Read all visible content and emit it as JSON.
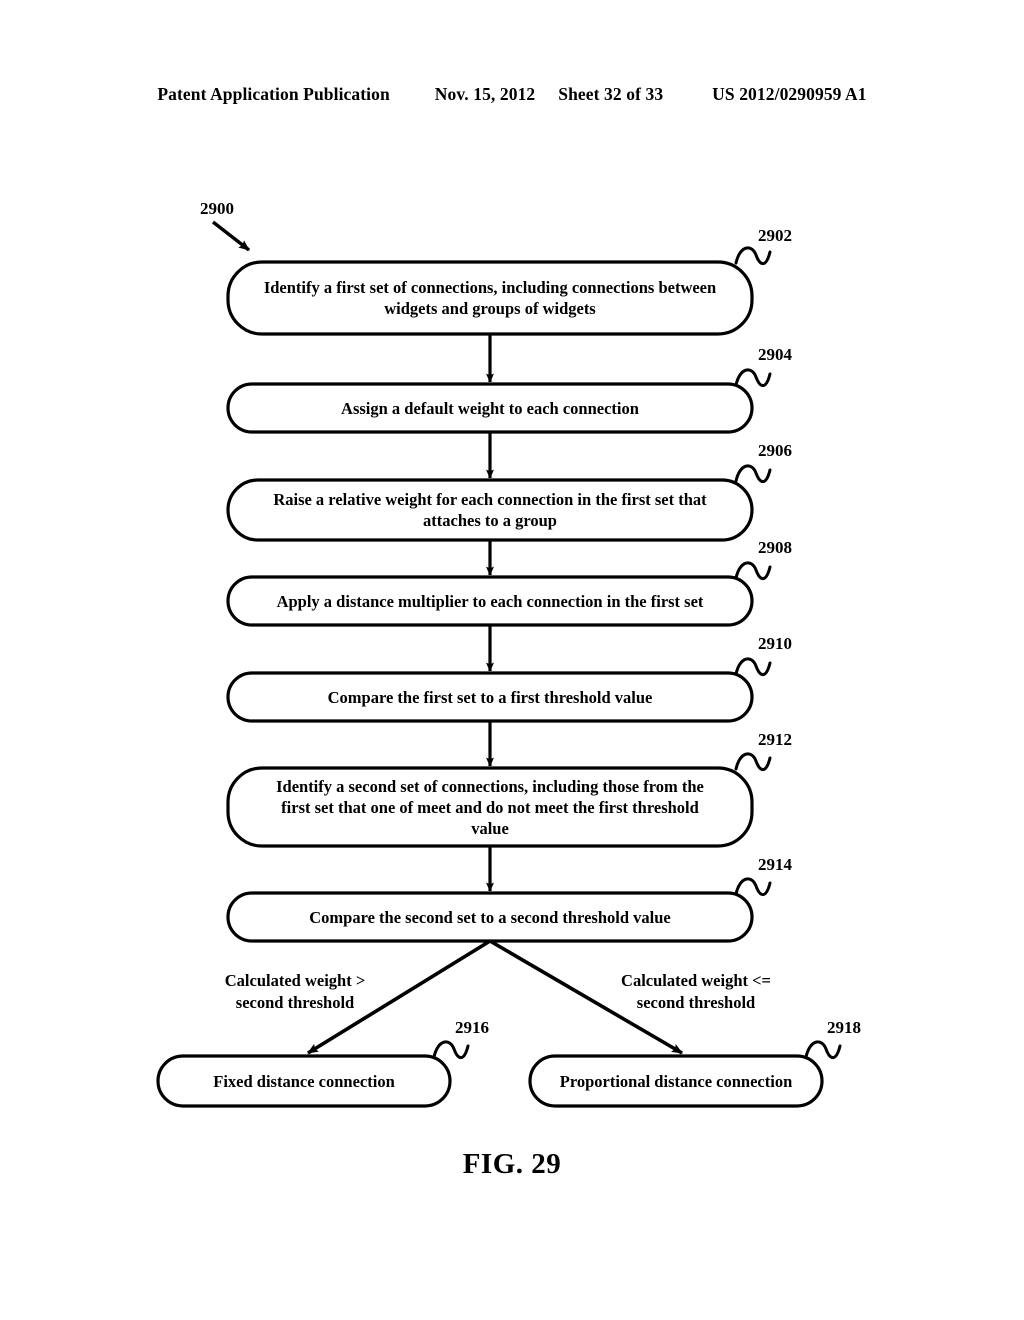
{
  "header": {
    "publication": "Patent Application Publication",
    "date": "Nov. 15, 2012",
    "sheet": "Sheet 32 of 33",
    "pub_number": "US 2012/0290959 A1"
  },
  "figure": {
    "caption": "FIG. 29",
    "diagram_ref": "2900"
  },
  "flowchart": {
    "type": "process-flow",
    "nodes": [
      {
        "ref": "2902",
        "text": "Identify a first set of connections, including connections between widgets and groups of widgets",
        "lines": [
          "Identify a first set of connections, including connections between",
          "widgets and groups of widgets"
        ]
      },
      {
        "ref": "2904",
        "text": "Assign a default weight to each connection",
        "lines": [
          "Assign a default weight to each connection"
        ]
      },
      {
        "ref": "2906",
        "text": "Raise a relative weight for each connection in the first set that attaches to a group",
        "lines": [
          "Raise a relative weight for each connection in the first set that",
          "attaches to a group"
        ]
      },
      {
        "ref": "2908",
        "text": "Apply a distance multiplier to each connection in the first set",
        "lines": [
          "Apply a distance multiplier to each connection in the first set"
        ]
      },
      {
        "ref": "2910",
        "text": "Compare the first set to a first threshold value",
        "lines": [
          "Compare the first set to a first threshold value"
        ]
      },
      {
        "ref": "2912",
        "text": "Identify a second set of connections, including those from the first set that one of meet and do not meet the first threshold value",
        "lines": [
          "Identify a second set of connections, including those from the",
          "first set that one of meet and do not meet the first threshold",
          "value"
        ]
      },
      {
        "ref": "2914",
        "text": "Compare the second set to a second threshold value",
        "lines": [
          "Compare the second set to a second threshold value"
        ]
      },
      {
        "ref": "2916",
        "text": "Fixed distance connection",
        "lines": [
          "Fixed distance connection"
        ]
      },
      {
        "ref": "2918",
        "text": "Proportional distance connection",
        "lines": [
          "Proportional distance connection"
        ]
      }
    ],
    "branch_labels": {
      "left": {
        "line1": "Calculated weight >",
        "line2": "second threshold"
      },
      "right": {
        "line1": "Calculated weight <=",
        "line2": "second threshold"
      }
    }
  }
}
